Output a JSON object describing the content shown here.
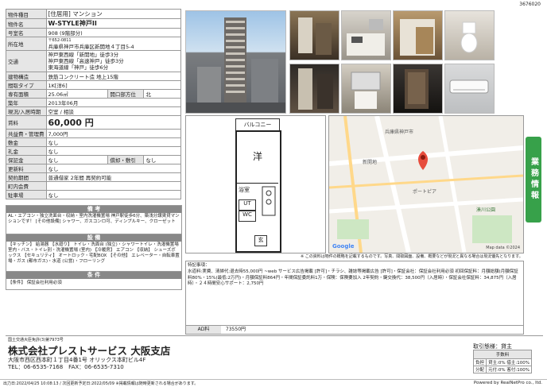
{
  "doc_id": "3676020",
  "spec": {
    "rows": [
      {
        "k": "物件種目",
        "v": "[住居用] マンション"
      },
      {
        "k": "物件名",
        "v": "W-STYLE神戸II"
      },
      {
        "k": "号室名",
        "v": "908 (9階部分)"
      },
      {
        "k": "所在地",
        "v1": "〒652-0811",
        "v": "兵庫県神戸市兵庫区新開地４丁目5-4"
      },
      {
        "k": "交通",
        "lines": [
          "神戸東西線「新開地」徒歩3分",
          "神戸東西線「高速神戸」徒歩3分",
          "東海道線「神戸」徒歩6分"
        ]
      },
      {
        "k": "建物構造",
        "v": "鉄筋コンクリート造 地上15階"
      },
      {
        "k": "間取タイプ",
        "v": "1K[洋6]"
      },
      {
        "k": "専有面積",
        "v": "25.06㎡",
        "k2": "開口部方位",
        "v2": "北"
      },
      {
        "k": "築年",
        "v": "2013年06月"
      },
      {
        "k": "現況/入居時期",
        "v": "空室 / 相談"
      },
      {
        "k": "賃料",
        "v": "60,000 円"
      },
      {
        "k": "共益費・管理費",
        "v": "7,000円"
      },
      {
        "k": "敷金",
        "v": "なし"
      },
      {
        "k": "礼金",
        "v": "なし"
      },
      {
        "k": "保証金",
        "v": "なし",
        "k2": "償却・敷引",
        "v2": "なし"
      },
      {
        "k": "更新料",
        "v": "なし"
      },
      {
        "k": "契約期間",
        "v": "普通借家 2年間 再契約可能"
      },
      {
        "k": "町内会費",
        "v": ""
      },
      {
        "k": "駐車場",
        "v": "なし"
      }
    ]
  },
  "bikou": {
    "title": "備 考",
    "text": "AL・エアコン・独立洗面台・収納・室内洗濯機置場 神戸駅徒歩6分、築浅分譲賃貸マンションです！ [その他設備] シャワー、ガスコンロ可、ディンプルキー、クローゼット"
  },
  "setsubi": {
    "title": "設 備",
    "text": "【キッチン】 給湯器 【水廻り】 トイレ・洗面台 (独立)・シャワートイレ・洗濯機置場室内・バス・トイレ別・洗濯機置場 (室内) 【冷暖房】 エアコン 【収納】 シューズボックス 【セキュリティ】 オートロック・宅配BOX 【その他】 エレベーター・自転車置場・ガス (都市ガス)・水道 (公営)・フローリング"
  },
  "jouken": {
    "title": "条 件",
    "text": "【条件】 保証会社利用必須"
  },
  "floorplan": {
    "balcony": "バルコニー",
    "room": "洋",
    "bath": "浴室",
    "ut": "UT",
    "wc": "WC",
    "genkan": "玄"
  },
  "map": {
    "labels": [
      "兵庫県神戸市",
      "新開地",
      "湊川公園",
      "ポートピア"
    ],
    "footer": "Map data ©2024"
  },
  "note": "※ この資料は物件の概略を記載するものです。写真、間取図面、設備、概要などが現況と異なる場合は現況優先となります。",
  "tokki": {
    "label": "特記事項：",
    "text": "水道料:実費、清掃代:退去時55,000円 ~web サービス広告掲載 [許可]・チラシ、雑誌等掲載広告 [許可]・保証会社：保証会社利用必須 初回保証料：月額総額(月額保証料80%・15%(最低:2万円)・月額保証料864円・年間保証委託料1万・保険：保険要加入 2年契約・鍵交換代：38,500円（入居時）・保証会社保証料：34,875円（入居時）・２４時間安心サポート：2,750円"
  },
  "ad": {
    "label": "AD料",
    "value": "73550円"
  },
  "side_tab": "業務情報",
  "company": {
    "license": "国土交通大臣免許(3)第7973号",
    "name": "株式会社プレストサービス 大阪支店",
    "addr": "大阪市西区西本町１丁目4番1号 オリックス本町ビル4F",
    "tel": "TEL：06-6535-7168　FAX：06-6535-7310"
  },
  "trade": {
    "title": "取引態様：貸主",
    "sub": "手数料",
    "r1k": "負担",
    "r1v": "貸主:0% 借主:100%",
    "r2k": "分配",
    "r2v": "元付:0% 客付:100%"
  },
  "footer": {
    "left": "出力日:2022/04/25 10:08:13 / 次回更新予定日:2022/05/09 ※掲載情報は随時更新される場合があります。",
    "right": "Powered by RealNetPro co., ltd."
  }
}
